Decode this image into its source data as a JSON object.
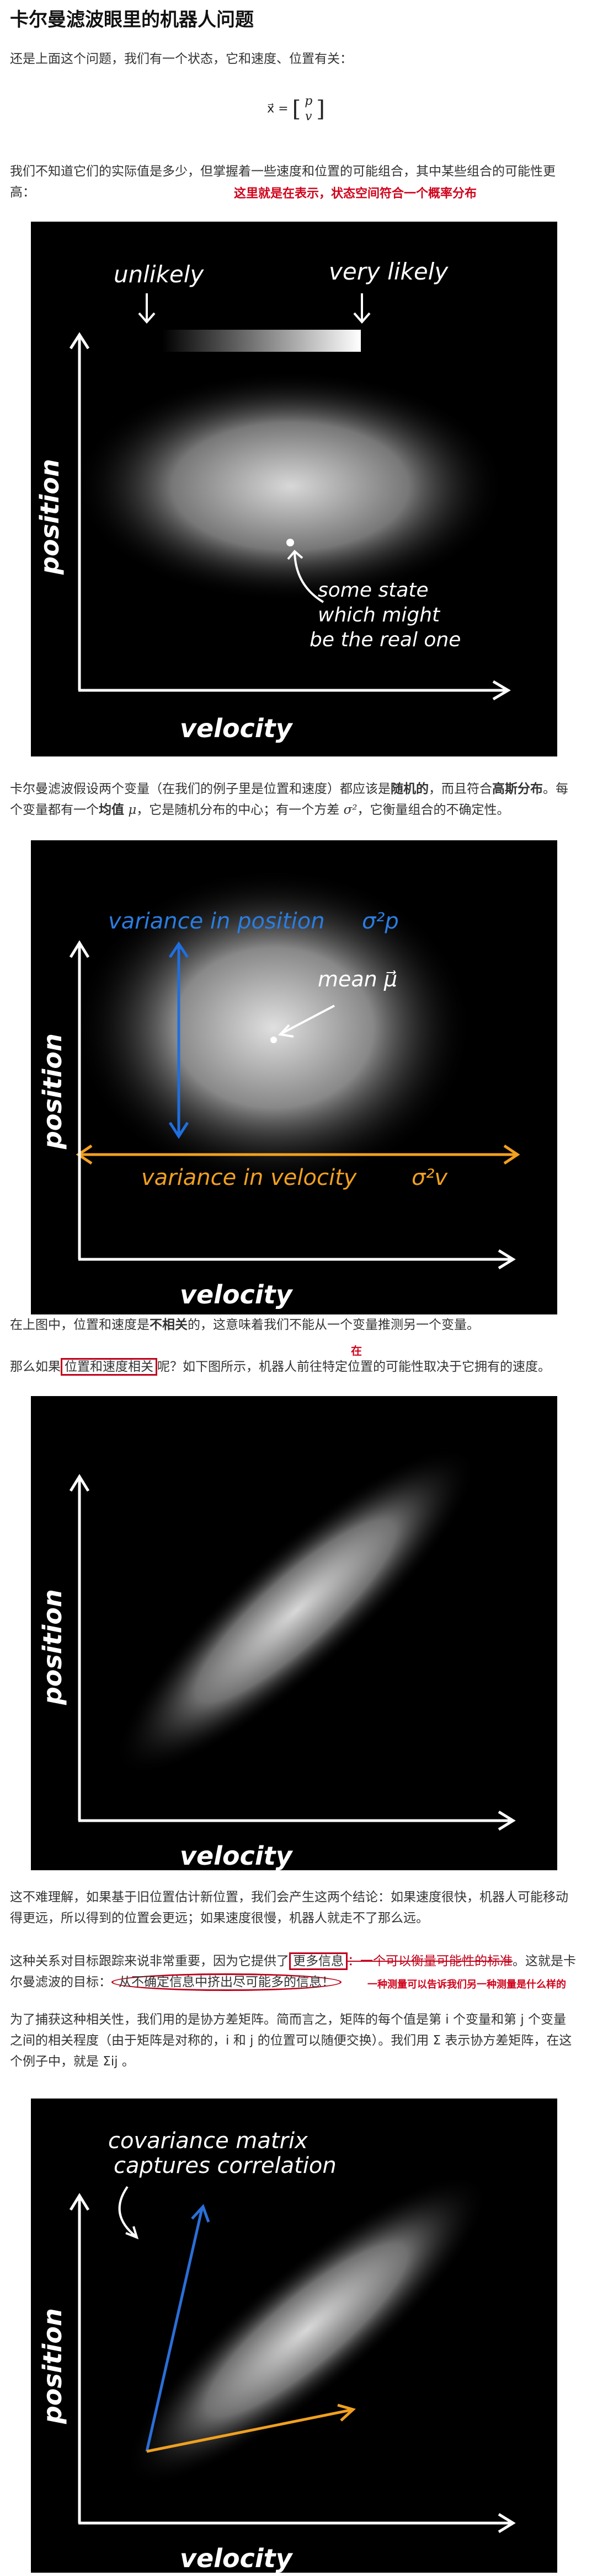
{
  "title": "卡尔曼滤波眼里的机器人问题",
  "intro": "还是上面这个问题，我们有一个状态，它和速度、位置有关：",
  "formula": {
    "lhs": "x⃗",
    "eq": "=",
    "top": "p",
    "bottom": "v"
  },
  "para1": "我们不知道它们的实际值是多少，但掌握着一些速度和位置的可能组合，其中某些组合的可能性更高：",
  "annot1": "这里就是在表示，状态空间符合一个概率分布",
  "fig1": {
    "unlikely": "unlikely",
    "very_likely": "very likely",
    "some_state": [
      "some state",
      "which might",
      "be the real one"
    ],
    "xlabel": "velocity",
    "ylabel": "position"
  },
  "para2_a": "卡尔曼滤波假设两个变量（在我们的例子里是位置和速度）都应该是",
  "para2_random": "随机的",
  "para2_b": "，而且符合",
  "para2_gauss": "高斯分布",
  "para2_c": "。每个变量都有一个",
  "para2_mean": "均值",
  "para2_mu": "μ",
  "para2_d": "，它是随机分布的中心；有一个方差",
  "para2_sigma": "σ²",
  "para2_e": "，它衡量组合的不确定性。",
  "fig2": {
    "var_pos": "variance in position",
    "sigma_p": "σ²p",
    "mean": "mean μ⃗",
    "var_vel": "variance in velocity",
    "sigma_v": "σ²v",
    "xlabel": "velocity",
    "ylabel": "position"
  },
  "para3_a": "在上图中，位置和速度是",
  "para3_b": "不相关",
  "para3_c": "的，这意味着我们不能从一个变量推测另一个变量。",
  "para4_a": "那么如果",
  "para4_box": "位置和速度相关",
  "para4_b": "呢？如下图所示，机器人前往特定位置的可能性取决于它拥有的速度。",
  "para4_mark": "在",
  "fig3": {
    "xlabel": "velocity",
    "ylabel": "position"
  },
  "para5": "这不难理解，如果基于旧位置估计新位置，我们会产生这两个结论：如果速度很快，机器人可能移动得更远，所以得到的位置会更远；如果速度很慢，机器人就走不了那么远。",
  "para6_a": "这种关系对目标跟踪来说非常重要，因为它提供了",
  "para6_box": "更多信息",
  "para6_strike": "：一个可以衡量可能性的标准",
  "para6_b": "。这就是卡尔曼滤波的目标：",
  "para6_circ": "从不确定信息中挤出尽可能多的信息！",
  "annot2": "一种测量可以告诉我们另一种测量是什么样的",
  "para7": "为了捕获这种相关性，我们用的是协方差矩阵。简而言之，矩阵的每个值是第 i 个变量和第 j 个变量之间的相关程度（由于矩阵是对称的，i 和 j 的位置可以随便交换）。我们用 Σ 表示协方差矩阵，在这个例子中，就是 Σij 。",
  "fig4": {
    "cov1": "covariance matrix",
    "cov2": "captures correlation",
    "xlabel": "velocity",
    "ylabel": "position"
  }
}
